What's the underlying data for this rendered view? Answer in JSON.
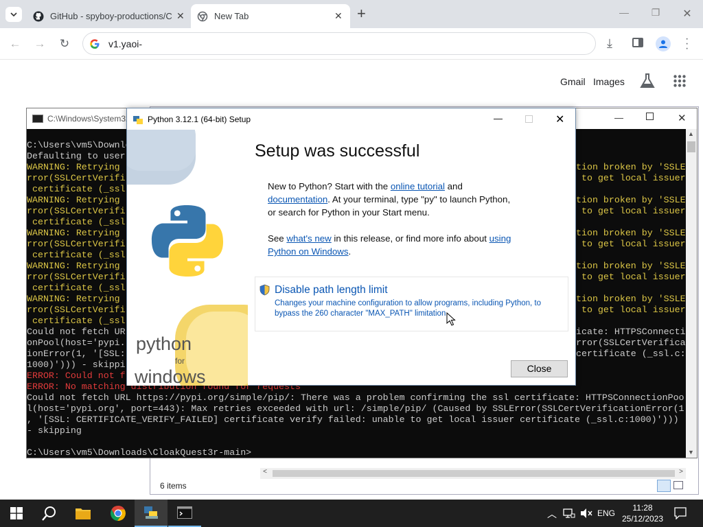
{
  "browser": {
    "tabs": [
      {
        "title": "GitHub - spyboy-productions/C"
      },
      {
        "title": "New Tab"
      }
    ],
    "address": "v1.yaoi-",
    "newtab_links": {
      "gmail": "Gmail",
      "images": "Images"
    }
  },
  "console": {
    "title": "C:\\Windows\\System32",
    "lines": [
      {
        "t": "C:\\Users\\vm5\\Downlo",
        "c": ""
      },
      {
        "t": "Defaulting to user",
        "c": ""
      },
      {
        "t": "WARNING: Retrying",
        "c": "y"
      },
      {
        "t": "rror(SSLCertVerifi",
        "c": "y"
      },
      {
        "t": " certificate (_ssl",
        "c": "y"
      },
      {
        "t": "WARNING: Retrying",
        "c": "y"
      },
      {
        "t": "rror(SSLCertVerifi",
        "c": "y"
      },
      {
        "t": " certificate (_ssl",
        "c": "y"
      },
      {
        "t": "WARNING: Retrying",
        "c": "y"
      },
      {
        "t": "rror(SSLCertVerifi",
        "c": "y"
      },
      {
        "t": " certificate (_ssl",
        "c": "y"
      },
      {
        "t": "WARNING: Retrying",
        "c": "y"
      },
      {
        "t": "rror(SSLCertVerifi",
        "c": "y"
      },
      {
        "t": " certificate (_ssl",
        "c": "y"
      },
      {
        "t": "WARNING: Retrying",
        "c": "y"
      },
      {
        "t": "rror(SSLCertVerifi",
        "c": "y"
      },
      {
        "t": " certificate (_ssl",
        "c": "y"
      },
      {
        "t": "Could not fetch UR",
        "c": ""
      },
      {
        "t": "onPool(host='pypi.",
        "c": ""
      },
      {
        "t": "ionError(1, '[SSL:",
        "c": ""
      },
      {
        "t": "1000)'))) - skippi",
        "c": ""
      },
      {
        "t": "ERROR: Could not f",
        "c": "r"
      },
      {
        "t": "ERROR: No matching distribution found for requests",
        "c": "r"
      },
      {
        "t": "Could not fetch URL https://pypi.org/simple/pip/: There was a problem confirming the ssl certificate: HTTPSConnectionPoo",
        "c": ""
      },
      {
        "t": "l(host='pypi.org', port=443): Max retries exceeded with url: /simple/pip/ (Caused by SSLError(SSLCertVerificationError(1",
        "c": ""
      },
      {
        "t": ", '[SSL: CERTIFICATE_VERIFY_FAILED] certificate verify failed: unable to get local issuer certificate (_ssl.c:1000)')))",
        "c": ""
      },
      {
        "t": "- skipping",
        "c": ""
      },
      {
        "t": "",
        "c": ""
      },
      {
        "t": "C:\\Users\\vm5\\Downloads\\CloakQuest3r-main>",
        "c": ""
      }
    ],
    "right_lines": [
      {
        "t": "",
        "c": ""
      },
      {
        "t": "",
        "c": ""
      },
      {
        "t": "tion broken by 'SSLE",
        "c": "y"
      },
      {
        "t": " to get local issuer",
        "c": "y"
      },
      {
        "t": "",
        "c": ""
      },
      {
        "t": "tion broken by 'SSLE",
        "c": "y"
      },
      {
        "t": " to get local issuer",
        "c": "y"
      },
      {
        "t": "",
        "c": ""
      },
      {
        "t": "tion broken by 'SSLE",
        "c": "y"
      },
      {
        "t": " to get local issuer",
        "c": "y"
      },
      {
        "t": "",
        "c": ""
      },
      {
        "t": "tion broken by 'SSLE",
        "c": "y"
      },
      {
        "t": " to get local issuer",
        "c": "y"
      },
      {
        "t": "",
        "c": ""
      },
      {
        "t": "tion broken by 'SSLE",
        "c": "y"
      },
      {
        "t": " to get local issuer",
        "c": "y"
      },
      {
        "t": "",
        "c": ""
      },
      {
        "t": "icate: HTTPSConnecti",
        "c": ""
      },
      {
        "t": "rror(SSLCertVerificat",
        "c": ""
      },
      {
        "t": "certificate (_ssl.c:",
        "c": ""
      }
    ]
  },
  "explorer": {
    "status": "6 items"
  },
  "setup": {
    "title": "Python 3.12.1 (64-bit) Setup",
    "heading": "Setup was successful",
    "p1_a": "New to Python? Start with the ",
    "p1_link1": "online tutorial",
    "p1_b": " and",
    "p1_link2": "documentation",
    "p1_c": ". At your terminal, type \"py\" to launch Python,",
    "p1_d": "or search for Python in your Start menu.",
    "p2_a": "See ",
    "p2_link1": "what's new",
    "p2_b": " in this release, or find more info about ",
    "p2_link2": "using",
    "p2_link3": "Python on Windows",
    "p2_c": ".",
    "path_title": "Disable path length limit",
    "path_desc1": "Changes your machine configuration to allow programs, including Python, to",
    "path_desc2": "bypass the 260 character \"MAX_PATH\" limitation.",
    "close": "Close",
    "brand_python": "python",
    "brand_for": "for",
    "brand_windows": "windows"
  },
  "taskbar": {
    "lang": "ENG",
    "time": "11:28",
    "date": "25/12/2023"
  },
  "colors": {
    "link": "#0a56b3",
    "warning": "#dcc646",
    "error": "#e23b3b"
  }
}
